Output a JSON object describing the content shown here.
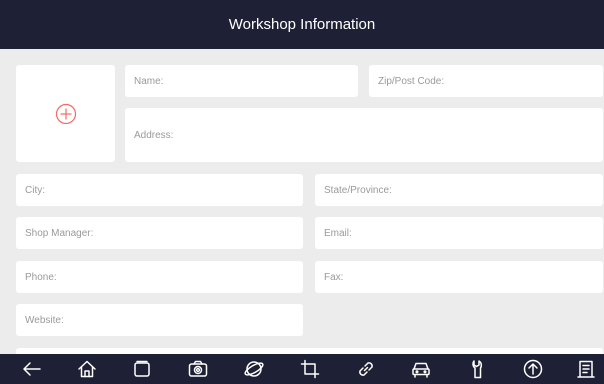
{
  "header": {
    "title": "Workshop Information"
  },
  "photo": {
    "icon": "add-circle-icon",
    "accent": "#f26a63"
  },
  "form": {
    "name": {
      "placeholder": "Name:",
      "value": ""
    },
    "zip": {
      "placeholder": "Zip/Post Code:",
      "value": ""
    },
    "address": {
      "placeholder": "Address:",
      "value": ""
    },
    "city": {
      "placeholder": "City:",
      "value": ""
    },
    "state": {
      "placeholder": "State/Province:",
      "value": ""
    },
    "manager": {
      "placeholder": "Shop Manager:",
      "value": ""
    },
    "email": {
      "placeholder": "Email:",
      "value": ""
    },
    "phone": {
      "placeholder": "Phone:",
      "value": ""
    },
    "fax": {
      "placeholder": "Fax:",
      "value": ""
    },
    "website": {
      "placeholder": "Website:",
      "value": ""
    }
  },
  "navbar": {
    "icons": [
      "back-icon",
      "home-icon",
      "recent-apps-icon",
      "camera-icon",
      "browser-icon",
      "crop-icon",
      "link-icon",
      "vehicle-icon",
      "wrench-icon",
      "upload-icon",
      "report-icon"
    ]
  },
  "colors": {
    "header_bg": "#1e2135",
    "page_bg": "#ececec",
    "field_bg": "#ffffff"
  }
}
